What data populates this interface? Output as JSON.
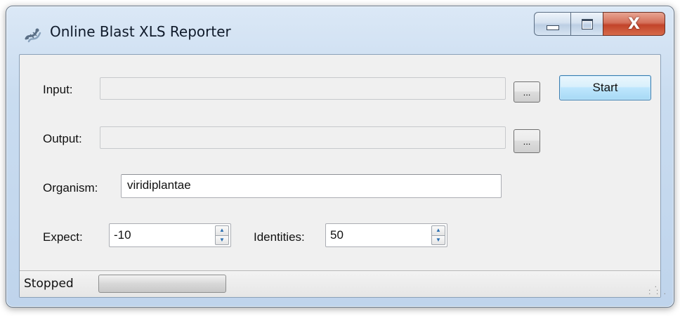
{
  "window": {
    "title": "Online Blast XLS Reporter",
    "icon": "blast-app-icon",
    "close_glyph": "X"
  },
  "form": {
    "input": {
      "label": "Input:",
      "value": "",
      "browse_label": "..."
    },
    "output": {
      "label": "Output:",
      "value": "",
      "browse_label": "..."
    },
    "start_label": "Start",
    "organism": {
      "label": "Organism:",
      "value": "viridiplantae"
    },
    "expect": {
      "label": "Expect:",
      "value": "-10"
    },
    "identities": {
      "label": "Identities:",
      "value": "50"
    }
  },
  "status": {
    "text": "Stopped",
    "progress": 0
  },
  "colors": {
    "default_button_border": "#3c7fb1",
    "close_button": "#c2442a",
    "spin_arrow": "#2b6fb0"
  }
}
